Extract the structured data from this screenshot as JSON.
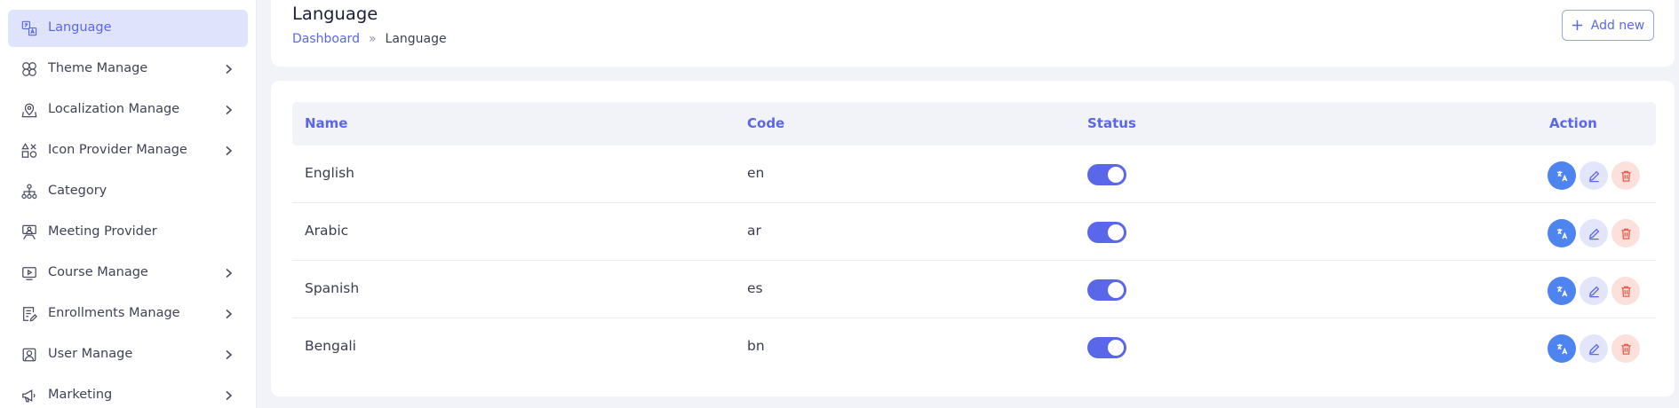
{
  "sidebar": {
    "items": [
      {
        "label": "Language",
        "icon": "translate-icon",
        "active": true,
        "chevron": false
      },
      {
        "label": "Theme Manage",
        "icon": "theme-icon",
        "active": false,
        "chevron": true
      },
      {
        "label": "Localization Manage",
        "icon": "map-pin-icon",
        "active": false,
        "chevron": true
      },
      {
        "label": "Icon Provider Manage",
        "icon": "shapes-icon",
        "active": false,
        "chevron": true
      },
      {
        "label": "Category",
        "icon": "hierarchy-icon",
        "active": false,
        "chevron": false
      },
      {
        "label": "Meeting Provider",
        "icon": "meeting-icon",
        "active": false,
        "chevron": false
      },
      {
        "label": "Course Manage",
        "icon": "video-icon",
        "active": false,
        "chevron": true
      },
      {
        "label": "Enrollments Manage",
        "icon": "form-icon",
        "active": false,
        "chevron": true
      },
      {
        "label": "User Manage",
        "icon": "user-icon",
        "active": false,
        "chevron": true
      },
      {
        "label": "Marketing",
        "icon": "megaphone-icon",
        "active": false,
        "chevron": true
      }
    ]
  },
  "header": {
    "title": "Language",
    "breadcrumb": {
      "home": "Dashboard",
      "separator": "»",
      "current": "Language"
    },
    "add_button": "Add new"
  },
  "table": {
    "columns": {
      "name": "Name",
      "code": "Code",
      "status": "Status",
      "action": "Action"
    },
    "rows": [
      {
        "name": "English",
        "code": "en",
        "status": true
      },
      {
        "name": "Arabic",
        "code": "ar",
        "status": true
      },
      {
        "name": "Spanish",
        "code": "es",
        "status": true
      },
      {
        "name": "Bengali",
        "code": "bn",
        "status": true
      }
    ]
  },
  "colors": {
    "accent": "#5a67e8",
    "translate_button": "#4d84ef",
    "edit_button_bg": "#e3e6fb",
    "delete_button_bg": "#fbe0dc",
    "delete_icon": "#ee5b4a",
    "active_menu_bg": "#dfe3fb"
  }
}
